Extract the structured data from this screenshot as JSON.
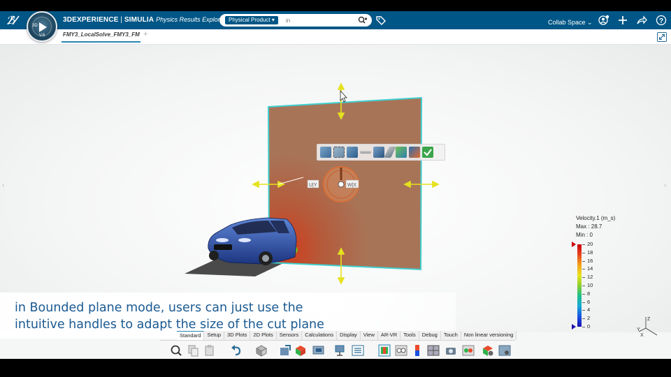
{
  "app": {
    "brand": "3DEXPERIENCE",
    "separator": " | ",
    "product": "SIMULIA",
    "app_name": "Physics Results Explorer",
    "compass_version": "V.6",
    "compass_label": "3D"
  },
  "search": {
    "scope": "Physical Product",
    "placeholder": "in"
  },
  "header": {
    "collab_space": "Collab Space"
  },
  "tabs": {
    "active": "FMY3_LocalSolve_FMY3_FM"
  },
  "plane": {
    "handle_left_label": "U|Y",
    "handle_right_label": "W|X"
  },
  "legend": {
    "title": "Velocity.1 (m_s)",
    "max": "Max : 28.7",
    "min": "Min : 0",
    "ticks": [
      "20",
      "18",
      "16",
      "14",
      "12",
      "10",
      "8",
      "6",
      "4",
      "2",
      "0"
    ]
  },
  "triad": {
    "z": "Z",
    "y": "Y",
    "x": "X"
  },
  "caption": {
    "line1": "in Bounded plane mode, users can just use the",
    "line2": "intuitive handles to adapt the size of the cut plane"
  },
  "action_bar": {
    "tabs": [
      "Standard",
      "Setup",
      "3D Plots",
      "2D Plots",
      "Sensors",
      "Calculations",
      "Display",
      "View",
      "AR-VR",
      "Tools",
      "Debug",
      "Touch",
      "Non linear versioning"
    ],
    "active_tab": "Standard"
  },
  "colors": {
    "topbar": "#005686",
    "plane_fill": "#a87458",
    "plane_edge": "#3fd0d0",
    "handle": "#e5e21e",
    "caption_text": "#1a5a92",
    "car": "#2b4fa8"
  }
}
